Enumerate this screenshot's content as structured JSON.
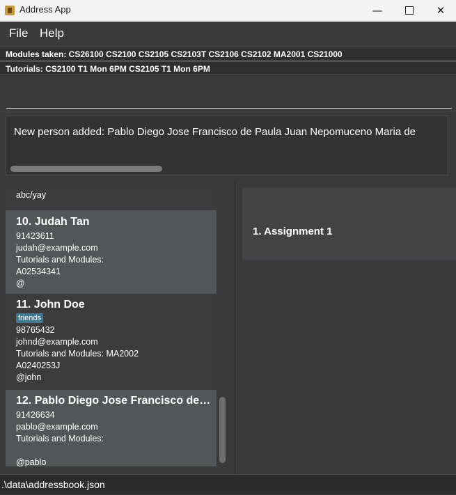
{
  "window": {
    "title": "Address App",
    "minimize": "—",
    "close": "✕"
  },
  "menu": {
    "file": "File",
    "help": "Help"
  },
  "info": {
    "modules": "Modules taken: CS26100 CS2100 CS2105 CS2103T CS2106 CS2102 MA2001 CS21000",
    "tutorials": "Tutorials: CS2100 T1 Mon 6PM  CS2105 T1 Mon 6PM"
  },
  "command": {
    "value": ""
  },
  "result": {
    "text": "New person added: Pablo Diego Jose Francisco de Paula Juan Nepomuceno Maria de"
  },
  "list": {
    "partial_line": "abc/yay",
    "persons": [
      {
        "name": "10.  Judah Tan",
        "phone": "91423611",
        "email": "judah@example.com",
        "tutorials": "Tutorials and Modules:",
        "id": "A02534341",
        "handle": "@"
      },
      {
        "name": "11.  John Doe",
        "tag": "friends",
        "phone": "98765432",
        "email": "johnd@example.com",
        "tutorials": "Tutorials and Modules: MA2002",
        "id": "A0240253J",
        "handle": "@john"
      },
      {
        "name": "12.  Pablo Diego Jose Francisco de P...",
        "phone": "91426634",
        "email": "pablo@example.com",
        "tutorials": "Tutorials and Modules:",
        "id": "",
        "handle": "@pablo"
      }
    ]
  },
  "assignments": [
    {
      "label": "1.  Assignment 1"
    }
  ],
  "status": {
    "path": ".\\data\\addressbook.json"
  },
  "colors": {
    "tag_bg": "#3d7a94",
    "selected_card": "#515658",
    "background": "#3a3a3a"
  }
}
